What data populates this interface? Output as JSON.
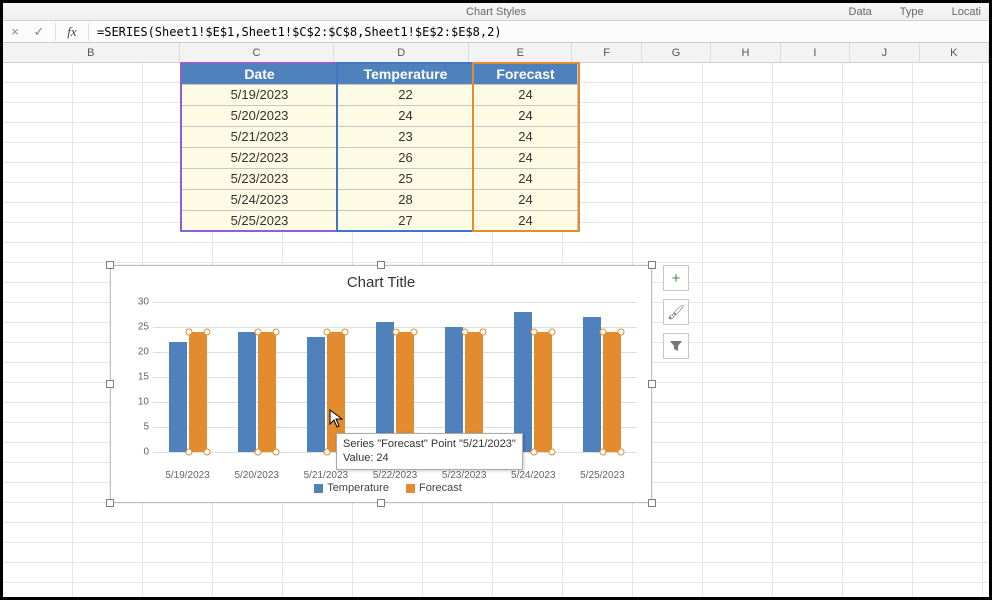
{
  "menu": {
    "center": "Chart Styles",
    "right": [
      "Data",
      "Type",
      "Locati"
    ]
  },
  "formula_bar": {
    "cancel": "×",
    "enter": "✓",
    "fx": "fx",
    "value": "=SERIES(Sheet1!$E$1,Sheet1!$C$2:$C$8,Sheet1!$E$2:$E$8,2)"
  },
  "columns": [
    "B",
    "C",
    "D",
    "E",
    "F",
    "G",
    "H",
    "I",
    "J",
    "K"
  ],
  "table": {
    "headers": [
      "Date",
      "Temperature",
      "Forecast"
    ],
    "rows": [
      [
        "5/19/2023",
        "22",
        "24"
      ],
      [
        "5/20/2023",
        "24",
        "24"
      ],
      [
        "5/21/2023",
        "23",
        "24"
      ],
      [
        "5/22/2023",
        "26",
        "24"
      ],
      [
        "5/23/2023",
        "25",
        "24"
      ],
      [
        "5/24/2023",
        "28",
        "24"
      ],
      [
        "5/25/2023",
        "27",
        "24"
      ]
    ]
  },
  "chart_data": {
    "type": "bar",
    "title": "Chart Title",
    "categories": [
      "5/19/2023",
      "5/20/2023",
      "5/21/2023",
      "5/22/2023",
      "5/23/2023",
      "5/24/2023",
      "5/25/2023"
    ],
    "series": [
      {
        "name": "Temperature",
        "values": [
          22,
          24,
          23,
          26,
          25,
          28,
          27
        ],
        "color": "#4f81bd"
      },
      {
        "name": "Forecast",
        "values": [
          24,
          24,
          24,
          24,
          24,
          24,
          24
        ],
        "color": "#e28c2f"
      }
    ],
    "ylabel": "",
    "xlabel": "",
    "ylim": [
      0,
      30
    ],
    "yticks": [
      0,
      5,
      10,
      15,
      20,
      25,
      30
    ],
    "legend_position": "bottom"
  },
  "tooltip": {
    "line1": "Series \"Forecast\" Point \"5/21/2023\"",
    "line2": "Value: 24"
  },
  "chart_buttons": {
    "plus": "+",
    "brush": "🖌",
    "funnel": "▾"
  }
}
